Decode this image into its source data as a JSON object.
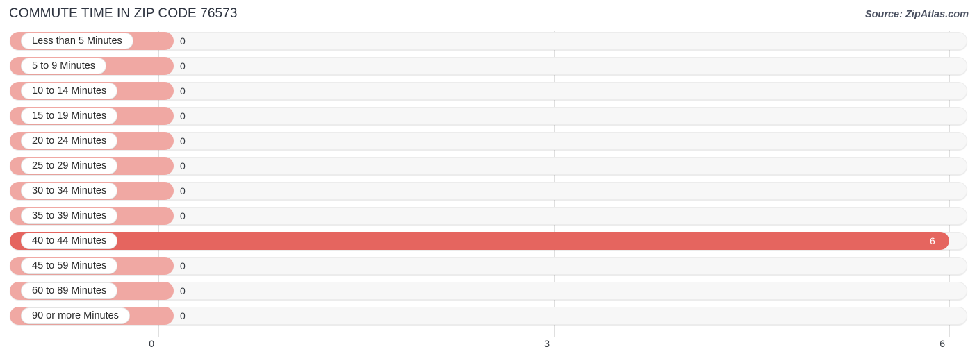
{
  "header": {
    "title": "COMMUTE TIME IN ZIP CODE 76573",
    "source": "Source: ZipAtlas.com"
  },
  "colors": {
    "bar": "#f0a8a3",
    "bar_highlight": "#e5655f",
    "track": "#f7f7f7",
    "gridline": "#dfdfdf",
    "title": "#2e3440"
  },
  "chart_data": {
    "type": "bar",
    "orientation": "horizontal",
    "title": "COMMUTE TIME IN ZIP CODE 76573",
    "xlabel": "",
    "ylabel": "",
    "xlim": [
      0,
      6
    ],
    "ticks": [
      "0",
      "3",
      "6"
    ],
    "tick_values": [
      0,
      3,
      6
    ],
    "grid": true,
    "legend": false,
    "categories": [
      "Less than 5 Minutes",
      "5 to 9 Minutes",
      "10 to 14 Minutes",
      "15 to 19 Minutes",
      "20 to 24 Minutes",
      "25 to 29 Minutes",
      "30 to 34 Minutes",
      "35 to 39 Minutes",
      "40 to 44 Minutes",
      "45 to 59 Minutes",
      "60 to 89 Minutes",
      "90 or more Minutes"
    ],
    "values": [
      0,
      0,
      0,
      0,
      0,
      0,
      0,
      0,
      6,
      0,
      0,
      0
    ],
    "value_labels": [
      "0",
      "0",
      "0",
      "0",
      "0",
      "0",
      "0",
      "0",
      "6",
      "0",
      "0",
      "0"
    ],
    "highlight_index": 8
  }
}
